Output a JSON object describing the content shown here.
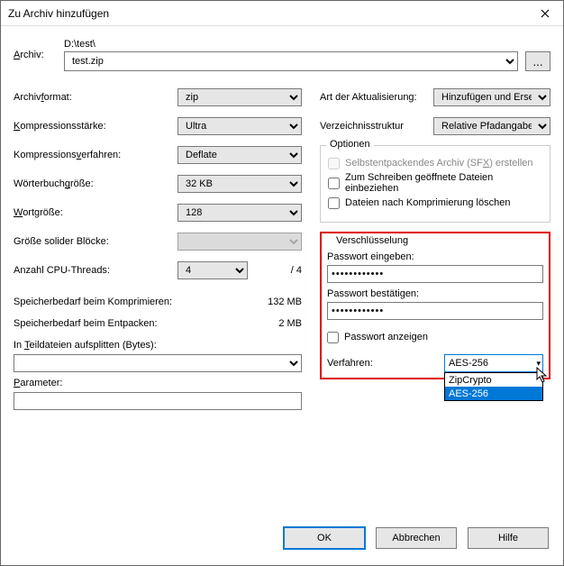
{
  "window": {
    "title": "Zu Archiv hinzufügen"
  },
  "archive": {
    "label": "Archiv:",
    "path": "D:\\test\\",
    "filename": "test.zip",
    "browse": "..."
  },
  "left": {
    "format_label": "Archivformat:",
    "format_value": "zip",
    "comp_label": "Kompressionsstärke:",
    "comp_value": "Ultra",
    "method_label": "Kompressionsverfahren:",
    "method_value": "Deflate",
    "dict_label": "Wörterbuchgröße:",
    "dict_value": "32 KB",
    "word_label": "Wortgröße:",
    "word_value": "128",
    "block_label": "Größe solider Blöcke:",
    "block_value": "",
    "threads_label": "Anzahl CPU-Threads:",
    "threads_value": "4",
    "threads_of": "/ 4",
    "mem_comp_label": "Speicherbedarf beim Komprimieren:",
    "mem_comp_value": "132 MB",
    "mem_decomp_label": "Speicherbedarf beim Entpacken:",
    "mem_decomp_value": "2 MB",
    "split_label": "In Teildateien aufsplitten (Bytes):",
    "split_value": "",
    "param_label": "Parameter:",
    "param_value": ""
  },
  "right": {
    "update_label": "Art der Aktualisierung:",
    "update_value": "Hinzufügen und Ersetzen",
    "paths_label": "Verzeichnisstruktur",
    "paths_value": "Relative Pfadangaben",
    "options_title": "Optionen",
    "sfx_label": "Selbstentpackendes Archiv (SFX) erstellen",
    "openfiles_label": "Zum Schreiben geöffnete Dateien einbeziehen",
    "delete_label": "Dateien nach Komprimierung löschen",
    "enc_title": "Verschlüsselung",
    "pw1_label": "Passwort eingeben:",
    "pw1_value": "••••••••••••",
    "pw2_label": "Passwort bestätigen:",
    "pw2_value": "••••••••••••",
    "showpw_label": "Passwort anzeigen",
    "method_label": "Verfahren:",
    "method_value": "AES-256",
    "method_options": {
      "opt1": "ZipCrypto",
      "opt2": "AES-256"
    }
  },
  "buttons": {
    "ok": "OK",
    "cancel": "Abbrechen",
    "help": "Hilfe"
  }
}
